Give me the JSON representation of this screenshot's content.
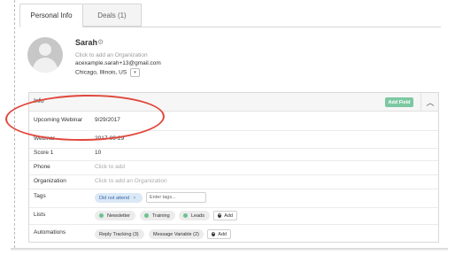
{
  "tabs": [
    {
      "label": "Personal Info",
      "active": true
    },
    {
      "label": "Deals (1)",
      "active": false
    }
  ],
  "profile": {
    "name": "Sarah",
    "organization_placeholder": "Click to add an Organization",
    "email": "acexample.sarah+13@gmail.com",
    "location": "Chicago, Illinois, US"
  },
  "info_panel": {
    "title": "Info",
    "add_field_label": "Add Field",
    "rows": {
      "upcoming_webinar": {
        "label": "Upcoming Webinar",
        "value": "9/29/2017"
      },
      "webinar": {
        "label": "Webinar",
        "value": "2017-09-29"
      },
      "score": {
        "label": "Score 1",
        "value": "10"
      },
      "phone": {
        "label": "Phone",
        "placeholder": "Click to add"
      },
      "organization": {
        "label": "Organization",
        "placeholder": "Click to add an Organization"
      },
      "tags": {
        "label": "Tags",
        "chips": [
          "Did not attend"
        ],
        "input_placeholder": "Enter tags..."
      },
      "lists": {
        "label": "Lists",
        "items": [
          "Newsletter",
          "Training",
          "Leads"
        ],
        "add_label": "Add"
      },
      "automations": {
        "label": "Automations",
        "items": [
          "Reply Tracking (3)",
          "Message Variable (2)"
        ],
        "add_label": "Add"
      }
    }
  },
  "colors": {
    "accent_green": "#7cc8a2",
    "annotation_red": "#e0473c",
    "tag_blue": "#dbe8f6"
  },
  "icons": [
    "gear-icon",
    "chevron-down-icon",
    "chevron-up-icon",
    "close-icon",
    "plus-icon",
    "check-dot-icon"
  ]
}
